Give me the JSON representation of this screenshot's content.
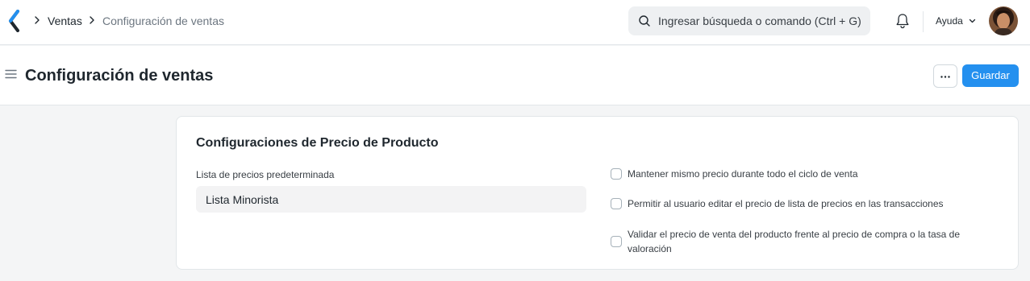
{
  "navbar": {
    "breadcrumbs": [
      "Ventas",
      "Configuración de ventas"
    ],
    "search_placeholder": "Ingresar búsqueda o comando (Ctrl + G)",
    "help_label": "Ayuda",
    "icons": [
      "app-logo-icon",
      "chevron-right-icon",
      "search-icon",
      "bell-icon",
      "chevron-down-icon"
    ]
  },
  "page": {
    "title": "Configuración de ventas",
    "more_label": "···",
    "save_label": "Guardar",
    "icons": [
      "menu-icon",
      "more-icon"
    ]
  },
  "section": {
    "title": "Configuraciones de Precio de Producto",
    "price_list": {
      "label": "Lista de precios predeterminada",
      "value": "Lista Minorista"
    },
    "checks": [
      {
        "label": "Mantener mismo precio durante todo el ciclo de venta",
        "checked": false
      },
      {
        "label": "Permitir al usuario editar el precio de lista de precios en las transacciones",
        "checked": false
      },
      {
        "label": "Validar el precio de venta del producto frente al precio de compra o la tasa de valoración",
        "checked": false
      }
    ]
  },
  "colors": {
    "accent": "#2490ef",
    "background": "#f4f5f6",
    "text": "#1f272e",
    "muted_text": "#6c7680"
  }
}
